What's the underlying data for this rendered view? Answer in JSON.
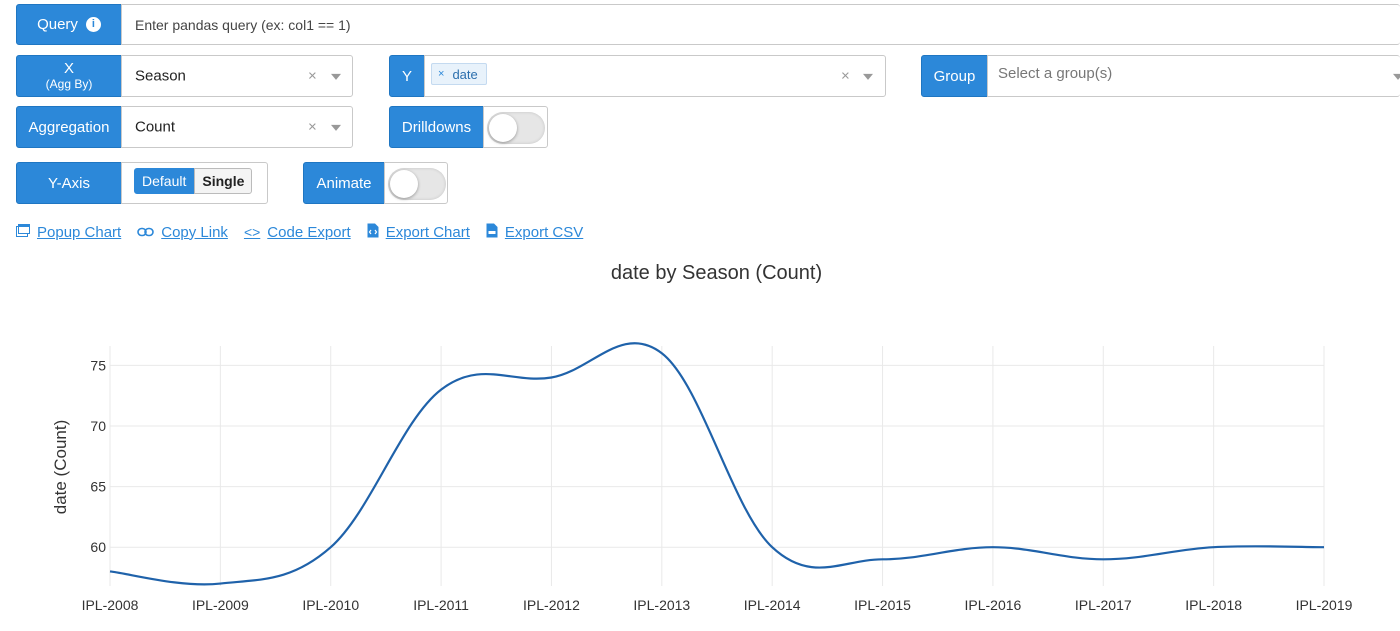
{
  "query": {
    "label": "Query",
    "info_icon": "info-icon",
    "placeholder": "Enter pandas query (ex: col1 == 1)"
  },
  "x_field": {
    "label_line1": "X",
    "label_line2": "(Agg By)",
    "value": "Season",
    "clear": "×"
  },
  "y_field": {
    "label": "Y",
    "chips": [
      "date"
    ],
    "chip_remove": "×",
    "clear": "×"
  },
  "group_field": {
    "label": "Group",
    "placeholder": "Select a group(s)"
  },
  "aggregation": {
    "label": "Aggregation",
    "value": "Count",
    "clear": "×"
  },
  "drilldowns": {
    "label": "Drilldowns",
    "enabled": false
  },
  "y_axis": {
    "label": "Y-Axis",
    "options": [
      "Default",
      "Single"
    ],
    "selected": "Default"
  },
  "animate": {
    "label": "Animate",
    "enabled": false
  },
  "links": {
    "popup": "Popup Chart",
    "copy": "Copy Link",
    "code_prefix": "<>",
    "code": "Code Export",
    "export_chart": "Export Chart",
    "export_csv": "Export CSV"
  },
  "colors": {
    "accent": "#2c88d9",
    "line": "#1f62aa",
    "grid": "#e9e9e9"
  },
  "chart_data": {
    "type": "line",
    "title": "date by Season (Count)",
    "xlabel": "",
    "ylabel": "date (Count)",
    "categories": [
      "IPL-2008",
      "IPL-2009",
      "IPL-2010",
      "IPL-2011",
      "IPL-2012",
      "IPL-2013",
      "IPL-2014",
      "IPL-2015",
      "IPL-2016",
      "IPL-2017",
      "IPL-2018",
      "IPL-2019"
    ],
    "values": [
      58,
      57,
      60,
      73,
      74,
      76,
      60,
      59,
      60,
      59,
      60,
      60
    ],
    "yticks": [
      60,
      65,
      70,
      75
    ],
    "ylim": [
      56.8,
      76.6
    ],
    "grid": true,
    "legend": "none"
  }
}
